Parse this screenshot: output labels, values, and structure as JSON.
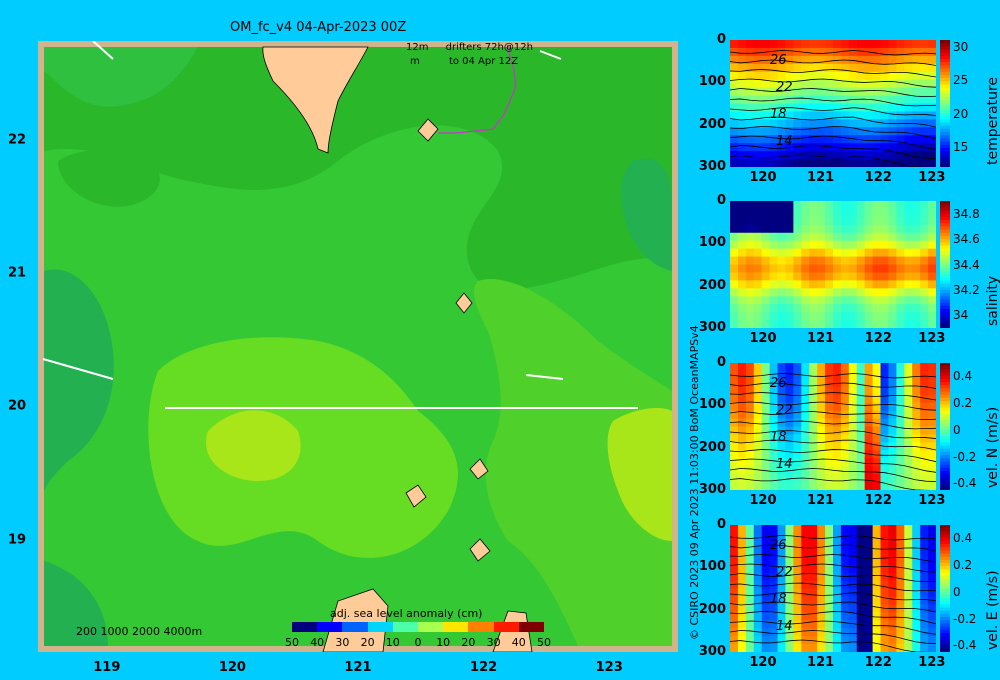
{
  "title": "OM_fc_v4  04-Apr-2023 00Z",
  "credit": "© CSIRO 2023   09 Apr 2023 11:03:00 BoM OceanMAPSv4",
  "drifter_legend": {
    "line1_left": "12m",
    "line1_right": "drifters 72h@12h",
    "line2_left": "m",
    "line2_right": "to 04 Apr 12Z"
  },
  "depth_legend": "200  1000  2000  4000m",
  "sla_colorbar": {
    "label": "adj. sea level anomaly (cm)",
    "ticks": [
      "-50",
      "-40",
      "-30",
      "-20",
      "-10",
      "0",
      "10",
      "20",
      "30",
      "40",
      "50"
    ],
    "colors": [
      "#00007f",
      "#0000ff",
      "#0063ff",
      "#00d4ff",
      "#4effa9",
      "#a9ff4e",
      "#ffe600",
      "#ff8000",
      "#ff1a00",
      "#7f0000"
    ]
  },
  "chart_data": [
    {
      "type": "heatmap",
      "name": "main-map",
      "title": "OM_fc_v4  04-Apr-2023 00Z",
      "x_ticks": [
        "119",
        "120",
        "121",
        "122",
        "123"
      ],
      "y_ticks": [
        "22",
        "21",
        "20",
        "19"
      ],
      "xlim": [
        118.5,
        123.5
      ],
      "ylim": [
        18.2,
        22.7
      ],
      "section_line": {
        "lon": [
          119.5,
          123.2
        ],
        "lat": [
          20.0,
          20.0
        ]
      },
      "colorbar_label": "adj. sea level anomaly (cm)",
      "vrange": [
        -50,
        50
      ]
    },
    {
      "type": "heatmap",
      "name": "temperature-section",
      "ylabel_right": "temperature",
      "y_ticks": [
        "0",
        "100",
        "200",
        "300"
      ],
      "x_ticks": [
        "120",
        "121",
        "122",
        "123"
      ],
      "colorbar_ticks": [
        "30",
        "25",
        "20",
        "15"
      ],
      "vrange": [
        12,
        31
      ],
      "contour_labels": [
        "26",
        "22",
        "18",
        "14"
      ]
    },
    {
      "type": "heatmap",
      "name": "salinity-section",
      "ylabel_right": "salinity",
      "y_ticks": [
        "0",
        "100",
        "200",
        "300"
      ],
      "x_ticks": [
        "120",
        "121",
        "122",
        "123"
      ],
      "colorbar_ticks": [
        "34.8",
        "34.6",
        "34.4",
        "34.2",
        "34"
      ],
      "vrange": [
        33.9,
        34.9
      ]
    },
    {
      "type": "heatmap",
      "name": "vel-n-section",
      "ylabel_right": "vel. N (m/s)",
      "y_ticks": [
        "0",
        "100",
        "200",
        "300"
      ],
      "x_ticks": [
        "120",
        "121",
        "122",
        "123"
      ],
      "colorbar_ticks": [
        "0.4",
        "0.2",
        "0",
        "-0.2",
        "-0.4"
      ],
      "vrange": [
        -0.45,
        0.5
      ],
      "contour_labels": [
        "26",
        "22",
        "18",
        "14"
      ]
    },
    {
      "type": "heatmap",
      "name": "vel-e-section",
      "ylabel_right": "vel. E (m/s)",
      "y_ticks": [
        "0",
        "100",
        "200",
        "300"
      ],
      "x_ticks": [
        "120",
        "121",
        "122",
        "123"
      ],
      "colorbar_ticks": [
        "0.4",
        "0.2",
        "0",
        "-0.2",
        "-0.4"
      ],
      "vrange": [
        -0.45,
        0.5
      ],
      "contour_labels": [
        "26",
        "22",
        "18",
        "14"
      ]
    }
  ]
}
